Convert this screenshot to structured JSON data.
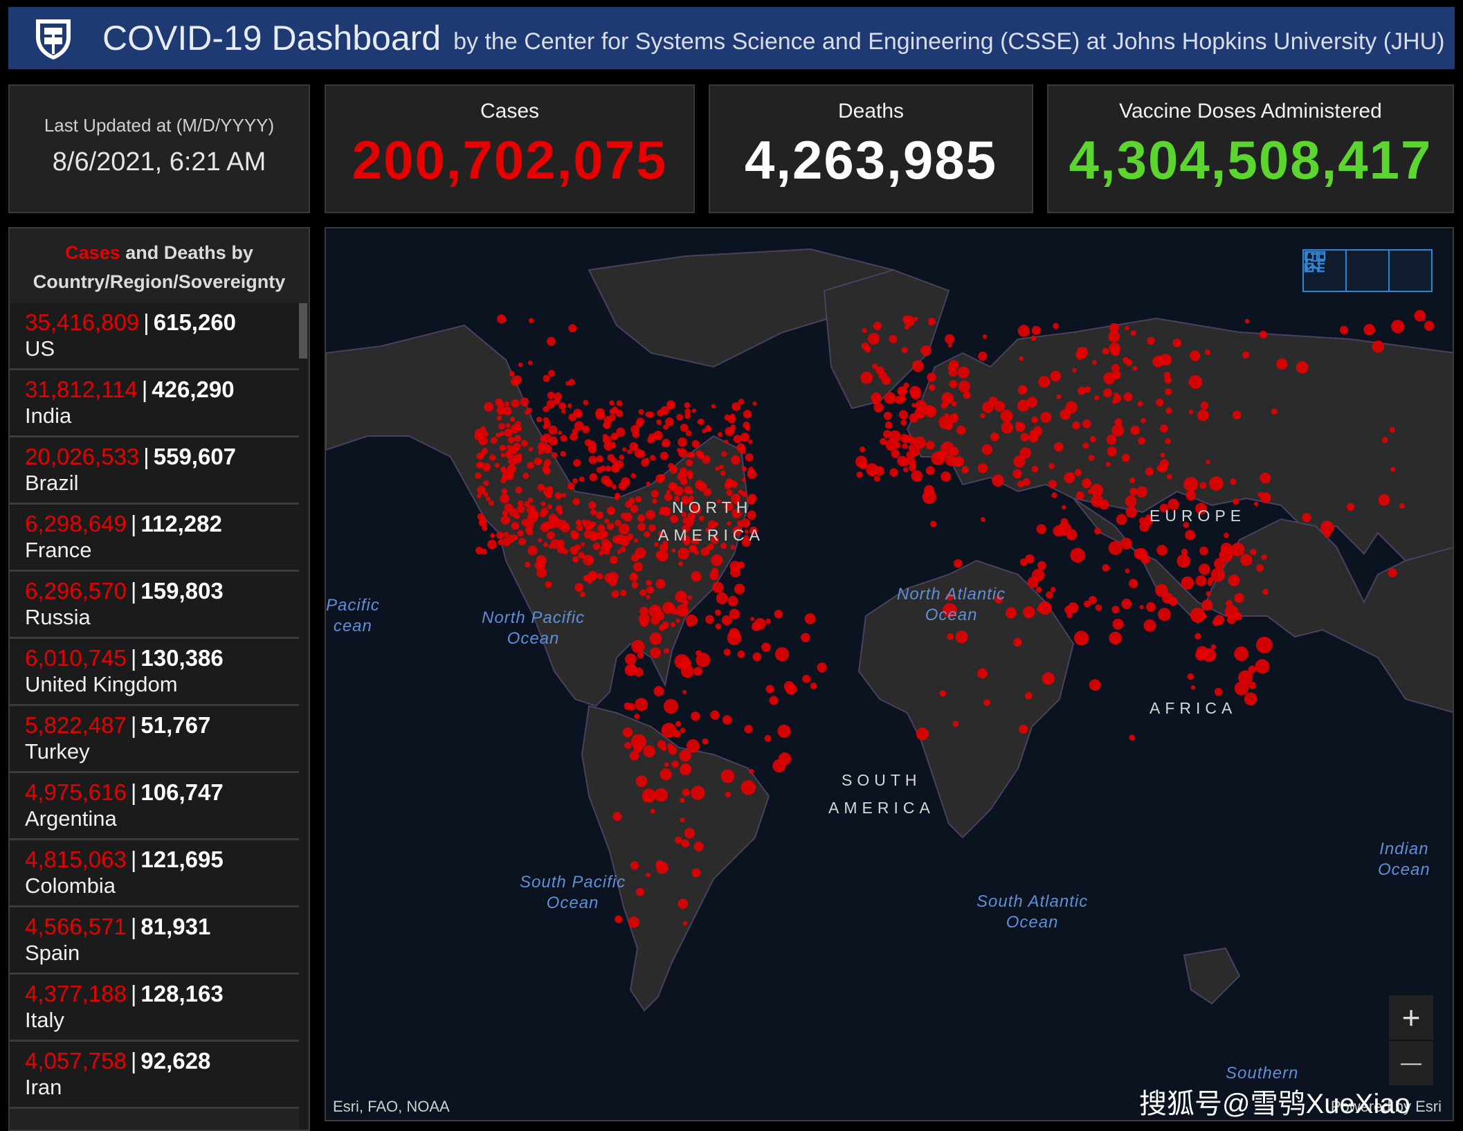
{
  "header": {
    "title": "COVID-19 Dashboard",
    "subtitle": "by the Center for Systems Science and Engineering (CSSE) at Johns Hopkins University (JHU)",
    "logo_icon": "jhu-shield-icon"
  },
  "updated": {
    "label": "Last Updated at (M/D/YYYY)",
    "value": "8/6/2021, 6:21 AM"
  },
  "stats": {
    "cases": {
      "label": "Cases",
      "value": "200,702,075",
      "color": "#e60000"
    },
    "deaths": {
      "label": "Deaths",
      "value": "4,263,985",
      "color": "#ffffff"
    },
    "vaccine": {
      "label": "Vaccine Doses Administered",
      "value": "4,304,508,417",
      "color": "#5cd62e"
    }
  },
  "list": {
    "title_cases": "Cases",
    "title_and": "and",
    "title_deaths": "Deaths",
    "title_rest": "by",
    "title_line2": "Country/Region/Sovereignty",
    "rows": [
      {
        "cases": "35,416,809",
        "deaths": "615,260",
        "name": "US"
      },
      {
        "cases": "31,812,114",
        "deaths": "426,290",
        "name": "India"
      },
      {
        "cases": "20,026,533",
        "deaths": "559,607",
        "name": "Brazil"
      },
      {
        "cases": "6,298,649",
        "deaths": "112,282",
        "name": "France"
      },
      {
        "cases": "6,296,570",
        "deaths": "159,803",
        "name": "Russia"
      },
      {
        "cases": "6,010,745",
        "deaths": "130,386",
        "name": "United Kingdom"
      },
      {
        "cases": "5,822,487",
        "deaths": "51,767",
        "name": "Turkey"
      },
      {
        "cases": "4,975,616",
        "deaths": "106,747",
        "name": "Argentina"
      },
      {
        "cases": "4,815,063",
        "deaths": "121,695",
        "name": "Colombia"
      },
      {
        "cases": "4,566,571",
        "deaths": "81,931",
        "name": "Spain"
      },
      {
        "cases": "4,377,188",
        "deaths": "128,163",
        "name": "Italy"
      },
      {
        "cases": "4,057,758",
        "deaths": "92,628",
        "name": "Iran"
      }
    ]
  },
  "map": {
    "oceans": {
      "pacific_edge": "Pacific\ncean",
      "north_pacific": "North Pacific\nOcean",
      "north_atlantic": "North Atlantic\nOcean",
      "south_pacific": "South Pacific\nOcean",
      "south_atlantic": "South Atlantic\nOcean",
      "indian": "Indian\nOcean",
      "southern": "Southern"
    },
    "continents": {
      "north_america_1": "NORTH",
      "north_america_2": "AMERICA",
      "europe": "EUROPE",
      "africa": "AFRICA",
      "south_america_1": "SOUTH",
      "south_america_2": "AMERICA"
    },
    "tools": [
      "bookmark-icon",
      "list-icon",
      "qr-grid-icon"
    ],
    "zoom_in": "+",
    "zoom_out": "—",
    "attribution": "Esri, FAO, NOAA",
    "powered": "Powered by Esri",
    "dot_color": "#e60000"
  },
  "watermark": "搜狐号@雪鸮XueXiao"
}
